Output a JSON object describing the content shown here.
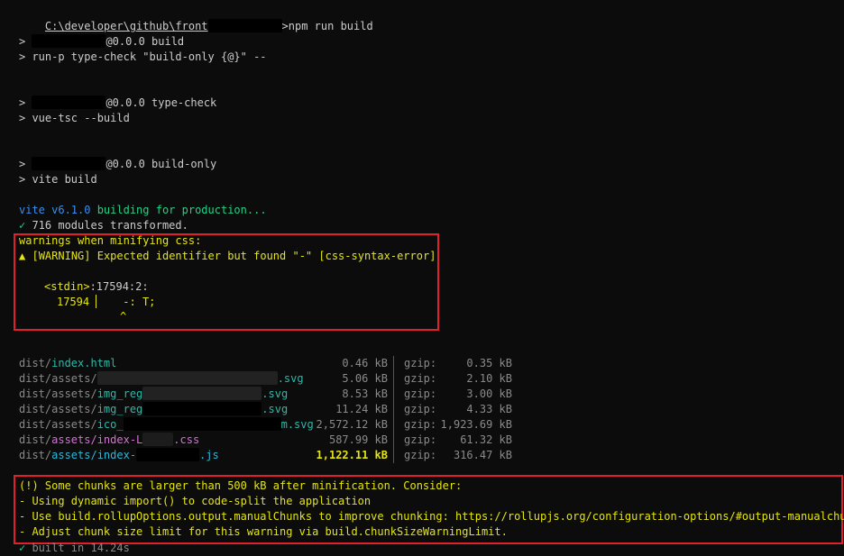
{
  "prompt": {
    "path_prefix": "C:\\developer\\github\\front",
    "command": "npm run build",
    "prompt_char": ">"
  },
  "steps": [
    {
      "version_suffix": "@0.0.0 build",
      "run": "> run-p type-check \"build-only {@}\" --"
    },
    {
      "version_suffix": "@0.0.0 type-check",
      "run": "> vue-tsc --build"
    },
    {
      "version_suffix": "@0.0.0 build-only",
      "run": "> vite build"
    }
  ],
  "vite": {
    "name": "vite v6.1.0",
    "building": " building for production...",
    "check_mark": "✓",
    "modules": " 716 modules transformed."
  },
  "css_warning": {
    "header": "warnings when minifying css:",
    "warning_icon": "▲",
    "warning_tag": "[WARNING]",
    "warning_text": "Expected identifier but found \"-\" [css-syntax-error]",
    "location_file": "<stdin>",
    "location_pos": ":17594:2:",
    "line_number": "17594",
    "line_code": "-: T;",
    "caret": "^"
  },
  "output_files": {
    "gzip_label": "gzip:",
    "rows": [
      {
        "dir": "dist/",
        "file": "index.html",
        "file_color": "teal",
        "size": "0.46 kB",
        "gzip": "0.35 kB"
      },
      {
        "dir": "dist/assets/",
        "file": ".svg",
        "file_color": "teal",
        "size": "5.06 kB",
        "gzip": "2.10 kB"
      },
      {
        "dir": "dist/assets/",
        "file": "img_reg",
        "file_color": "teal",
        "size": "8.53 kB",
        "gzip": "3.00 kB"
      },
      {
        "dir": "dist/assets/",
        "file": "img_reg",
        "file_color": "teal",
        "size": "11.24 kB",
        "gzip": "4.33 kB"
      },
      {
        "dir": "dist/assets/",
        "file": "ico_",
        "file_color": "teal",
        "size": "2,572.12 kB",
        "gzip": "1,923.69 kB"
      },
      {
        "dir": "dist/",
        "file": "assets/index-L",
        "file_color": "magenta",
        "size": "587.99 kB",
        "gzip": "61.32 kB"
      },
      {
        "dir": "dist/",
        "file": "assets/index-",
        "file_color": "cyan",
        "size": "1,122.11 kB",
        "gzip": "316.47 kB"
      }
    ],
    "row_tails": [
      ".svg",
      ".svg",
      ".svg",
      "m.svg",
      ".css",
      ".js"
    ]
  },
  "chunk_warning": {
    "lines": [
      "(!) Some chunks are larger than 500 kB after minification. Consider:",
      "- Using dynamic import() to code-split the application",
      "- Use build.rollupOptions.output.manualChunks to improve chunking: https://rollupjs.org/configuration-options/#output-manualchunks",
      "- Adjust chunk size limit for this warning via build.chunkSizeWarningLimit."
    ]
  },
  "built": {
    "check_mark": "✓",
    "text": " built in 14.24s"
  },
  "colors": {
    "background": "#0c0c0c",
    "text": "#cccccc",
    "vite_blue": "#3b8eea",
    "success_green": "#23d18b",
    "warning_yellow": "#e5e510",
    "highlight_box": "#e0202a"
  }
}
